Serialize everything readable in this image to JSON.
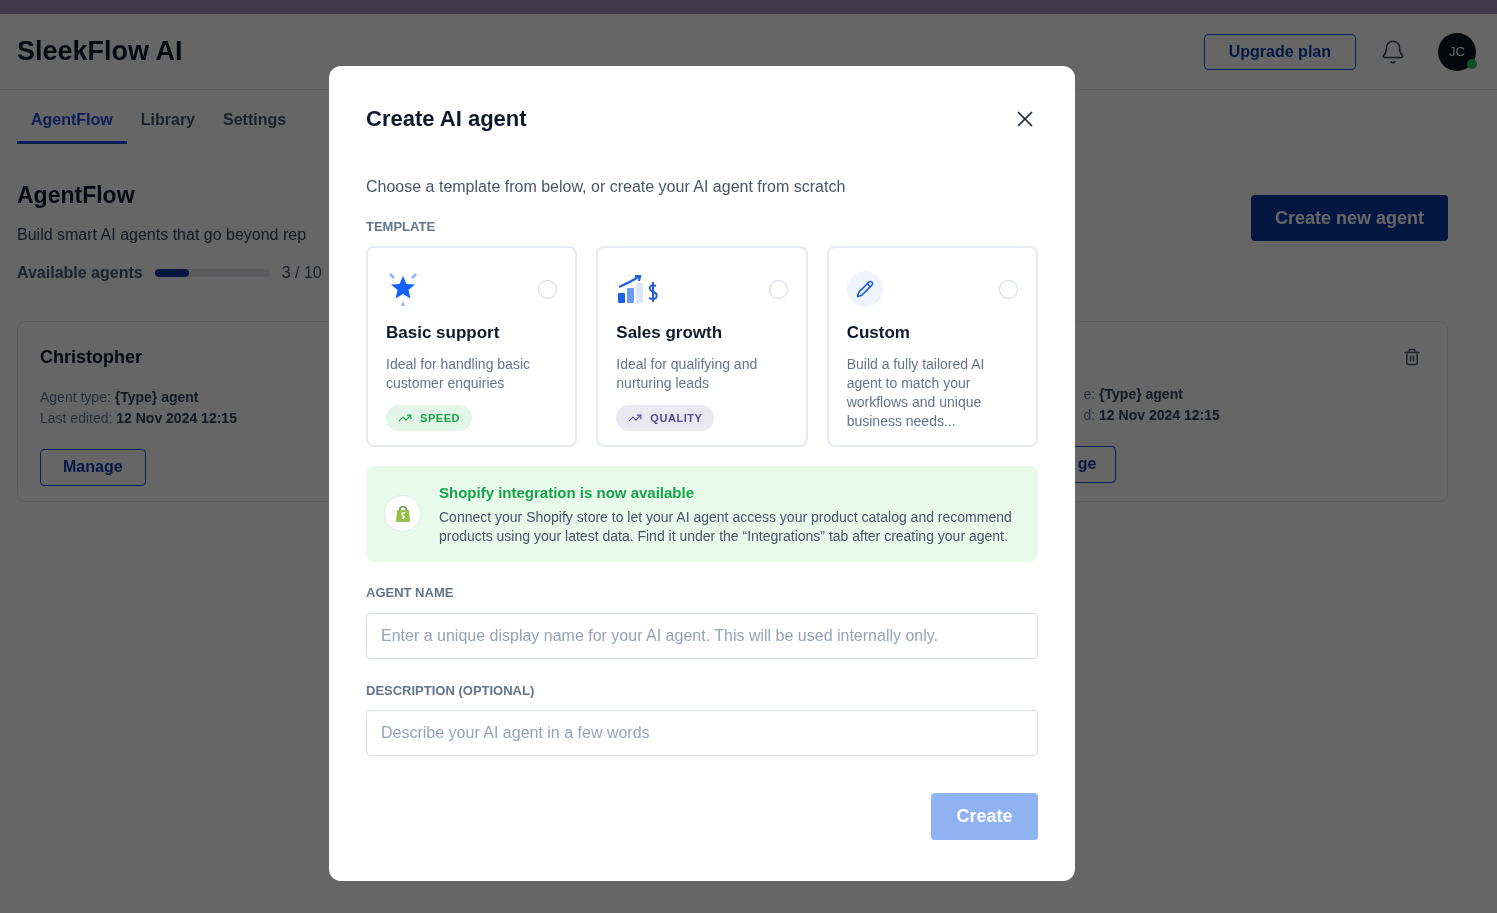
{
  "app": {
    "title": "SleekFlow AI",
    "upgrade_button": "Upgrade plan",
    "avatar": {
      "initials": "JC",
      "online": true
    }
  },
  "tabs": [
    {
      "label": "AgentFlow",
      "selected": true
    },
    {
      "label": "Library",
      "selected": false
    },
    {
      "label": "Settings",
      "selected": false
    }
  ],
  "page": {
    "heading": "AgentFlow",
    "subtitle": "Build smart AI agents that go beyond rep",
    "usage": {
      "label": "Available agents",
      "level": 0.3,
      "reading": "3 / 10"
    },
    "create_button": "Create new agent"
  },
  "agents": [
    {
      "name": "Christopher",
      "type_line": "Agent type: **{Type} agent**",
      "edited_line": "Last edited: **12 Nov 2024 12:15**",
      "button": "Manage",
      "show_delete": false,
      "cut": false
    },
    {
      "type_line": "e: **{Type} agent**",
      "edited_line": "d: **12 Nov 2024 12:15**",
      "button": "ge",
      "show_delete": true,
      "cut": true
    }
  ],
  "modal": {
    "title": "Create AI agent",
    "intro": "Choose a template from below, or create your AI agent from scratch",
    "template_label": "TEMPLATE",
    "templates": [
      {
        "kind": "star",
        "title": "Basic support",
        "description": "Ideal for handling basic customer enquiries",
        "tag": {
          "label": "SPEED",
          "color": "#16a34a"
        },
        "selected": false
      },
      {
        "kind": "chart",
        "title": "Sales growth",
        "description": "Ideal for qualifying and nurturing leads",
        "tag": {
          "label": "QUALITY",
          "color": "#4f4a8f"
        },
        "selected": false
      },
      {
        "kind": "pencil",
        "title": "Custom",
        "description": "Build a fully tailored AI agent to match your workflows and unique business needs...",
        "selected": false
      }
    ],
    "banner": {
      "title": "Shopify integration is now available",
      "text": "Connect your Shopify store to let your AI agent access your product catalog and recommend products using your latest data. Find it under the “Integrations” tab after creating your agent."
    },
    "fields": [
      {
        "label": "AGENT NAME",
        "placeholder": "Enter a unique display name for your AI agent. This will be used internally only."
      },
      {
        "label": "DESCRIPTION (OPTIONAL)",
        "placeholder": "Describe your AI agent in a few words"
      }
    ],
    "submit": {
      "label": "Create",
      "disabled": true
    }
  }
}
